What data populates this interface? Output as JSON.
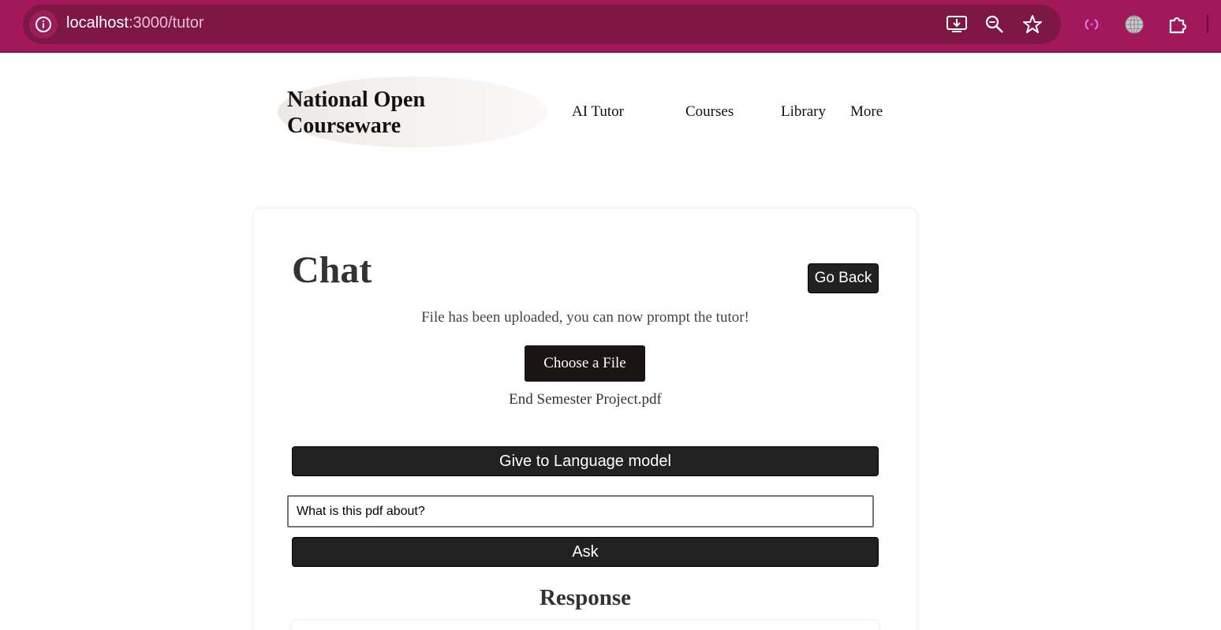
{
  "browser": {
    "url_host": "localhost",
    "url_path": ":3000/tutor",
    "icons": [
      "info-icon",
      "install-app-icon",
      "zoom-icon",
      "bookmark-star-icon",
      "extension-dot-icon",
      "globe-icon",
      "puzzle-extensions-icon"
    ],
    "bar_color": "#a3185a"
  },
  "header": {
    "brand": "National Open Courseware",
    "nav": [
      "AI Tutor",
      "Courses",
      "Library",
      "More"
    ]
  },
  "chat": {
    "title": "Chat",
    "go_back_label": "Go Back",
    "status": "File has been uploaded, you can now prompt the tutor!",
    "choose_file_label": "Choose a File",
    "file_name": "End Semester Project.pdf",
    "give_to_model_label": "Give to Language model",
    "prompt_value": "What is this pdf about?",
    "ask_label": "Ask",
    "response_title": "Response"
  },
  "colors": {
    "button_dark": "#212121",
    "choose_file_bg": "#1c1414"
  }
}
